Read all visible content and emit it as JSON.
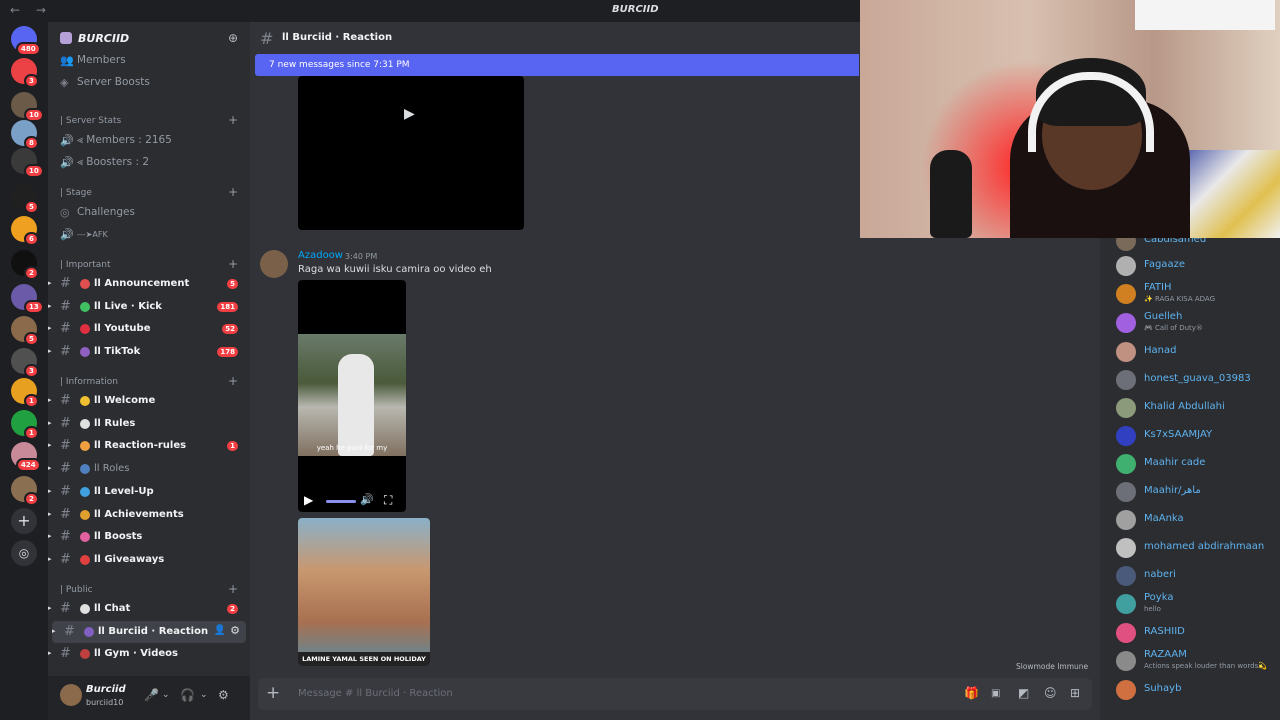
{
  "window": {
    "nav": "← →",
    "title": "BURCIID"
  },
  "guilds": [
    {
      "badge": "480",
      "color": "#5865f2"
    },
    {
      "badge": "3",
      "color": "#ed4245"
    },
    {
      "badge": "10",
      "color": "#6b5a48"
    },
    {
      "badge": "8",
      "color": "#7aa0c8"
    },
    {
      "badge": "10",
      "color": "#3a3a3a"
    },
    {
      "badge": "5",
      "color": "#202020"
    },
    {
      "badge": "6",
      "color": "#f0a020"
    },
    {
      "badge": "2",
      "color": "#101010"
    },
    {
      "badge": "13",
      "color": "#6a5aa8"
    },
    {
      "badge": "5",
      "color": "#8a6a4a"
    },
    {
      "badge": "3",
      "color": "#505050"
    },
    {
      "badge": "1",
      "color": "#e8a020"
    },
    {
      "badge": "1",
      "color": "#20a040"
    },
    {
      "badge": "424",
      "color": "#c88a98"
    },
    {
      "badge": "2",
      "color": "#8a7050"
    }
  ],
  "server": {
    "name": "BURCIID"
  },
  "channels": {
    "top": [
      {
        "label": "Members",
        "icon": "👥"
      },
      {
        "label": "Server Boosts",
        "icon": "◈"
      }
    ],
    "stats_category": "| Server Stats",
    "stats": [
      {
        "label": "⪡ Members : 2165"
      },
      {
        "label": "⪡ Boosters : 2"
      }
    ],
    "stage_category": "| Stage",
    "stage": [
      {
        "label": "Challenges",
        "icon": "◎"
      },
      {
        "label": "---➤AFK",
        "icon": "🔊"
      }
    ],
    "important_category": "| Important",
    "important": [
      {
        "label": "ll Announcement",
        "badge": "5",
        "color": "#e05050"
      },
      {
        "label": "ll Live · Kick",
        "badge": "181",
        "color": "#40c060"
      },
      {
        "label": "ll Youtube",
        "badge": "52",
        "color": "#e03040"
      },
      {
        "label": "ll TikTok",
        "badge": "178",
        "color": "#9060c0"
      }
    ],
    "info_category": "| Information",
    "info": [
      {
        "label": "ll Welcome",
        "badge": "",
        "color": "#f0c030"
      },
      {
        "label": "ll Rules",
        "badge": "",
        "color": "#e0e0e0"
      },
      {
        "label": "ll Reaction-rules",
        "badge": "1",
        "color": "#f0a040"
      },
      {
        "label": "ll Roles",
        "badge": "",
        "color": "#5080c0"
      },
      {
        "label": "ll Level-Up",
        "badge": "",
        "color": "#40a0e0"
      },
      {
        "label": "ll Achievements",
        "badge": "",
        "color": "#e0a030"
      },
      {
        "label": "ll Boosts",
        "badge": "",
        "color": "#e060a0"
      },
      {
        "label": "ll Giveaways",
        "badge": "",
        "color": "#e04040"
      }
    ],
    "public_category": "| Public",
    "public": [
      {
        "label": "ll Chat",
        "badge": "2",
        "color": "#e0e0e0"
      },
      {
        "label": "ll Burciid · Reaction",
        "badge": "",
        "color": "#8060c0"
      },
      {
        "label": "ll Gym · Videos",
        "badge": "",
        "color": "#c04040"
      }
    ]
  },
  "user": {
    "name": "Burciid",
    "status": "burciid10"
  },
  "chat": {
    "channel": "ll Burciid · Reaction",
    "new_messages": "7 new messages since 7:31 PM",
    "message": {
      "author": "Azadoow",
      "time": "3:40 PM",
      "text": "Raga wa kuwii isku camira oo video eh"
    },
    "video_caption": "yeah he paid for my",
    "image_banner": "LAMINE YAMAL SEEN ON HOLIDAY",
    "slowmode": "Slowmode Immune",
    "placeholder": "Message # ll Burciid · Reaction"
  },
  "members": [
    {
      "name": "Cabdisamed",
      "sub": "",
      "color": "#7a6a5a"
    },
    {
      "name": "Fagaaze",
      "sub": "",
      "color": "#b0b0b0"
    },
    {
      "name": "FATIH",
      "sub": "✨ RAGA KISA ADAG",
      "color": "#d08020"
    },
    {
      "name": "Guelleh",
      "sub": "🎮 Call of Duty®",
      "color": "#a060e0"
    },
    {
      "name": "Hanad",
      "sub": "",
      "color": "#c09080"
    },
    {
      "name": "honest_guava_03983",
      "sub": "",
      "color": "#6d6f78"
    },
    {
      "name": "Khalid Abdullahi",
      "sub": "",
      "color": "#8a9a7a"
    },
    {
      "name": "Ks7xSAAMJAY",
      "sub": "",
      "color": "#3040c0"
    },
    {
      "name": "Maahir cade",
      "sub": "",
      "color": "#40b070"
    },
    {
      "name": "Maahir/ماهر",
      "sub": "",
      "color": "#6d6f78"
    },
    {
      "name": "MaAnka",
      "sub": "",
      "color": "#a0a0a0"
    },
    {
      "name": "mohamed abdirahmaan",
      "sub": "",
      "color": "#c0c0c0"
    },
    {
      "name": "naberi",
      "sub": "",
      "color": "#4a5a7a"
    },
    {
      "name": "Poyka",
      "sub": "hello",
      "color": "#40a0a0"
    },
    {
      "name": "RASHIID",
      "sub": "",
      "color": "#e05080"
    },
    {
      "name": "RAZAAM",
      "sub": "Actions speak louder than words💫",
      "color": "#8a8a8a"
    },
    {
      "name": "Suhayb",
      "sub": "",
      "color": "#d07040"
    }
  ]
}
